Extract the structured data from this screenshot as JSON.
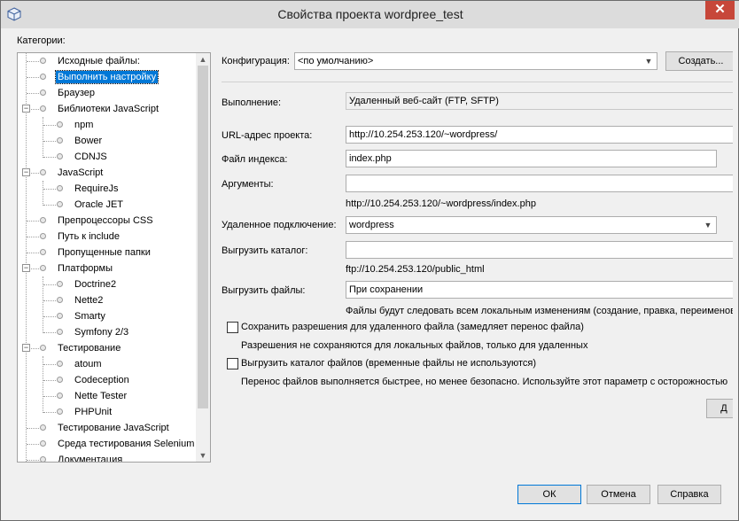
{
  "window": {
    "title": "Свойства проекта wordpree_test",
    "close_label": "✕"
  },
  "categories_label": "Категории:",
  "tree": {
    "items": [
      {
        "label": "Исходные файлы:"
      },
      {
        "label": "Выполнить настройку"
      },
      {
        "label": "Браузер"
      },
      {
        "label": "Библиотеки JavaScript"
      },
      {
        "label": "npm"
      },
      {
        "label": "Bower"
      },
      {
        "label": "CDNJS"
      },
      {
        "label": "JavaScript"
      },
      {
        "label": "RequireJs"
      },
      {
        "label": "Oracle JET"
      },
      {
        "label": "Препроцессоры CSS"
      },
      {
        "label": "Путь к include"
      },
      {
        "label": "Пропущенные папки"
      },
      {
        "label": "Платформы"
      },
      {
        "label": "Doctrine2"
      },
      {
        "label": "Nette2"
      },
      {
        "label": "Smarty"
      },
      {
        "label": "Symfony 2/3"
      },
      {
        "label": "Тестирование"
      },
      {
        "label": "atoum"
      },
      {
        "label": "Codeception"
      },
      {
        "label": "Nette Tester"
      },
      {
        "label": "PHPUnit"
      },
      {
        "label": "Тестирование JavaScript"
      },
      {
        "label": "Среда тестирования Selenium"
      },
      {
        "label": "Документация"
      }
    ]
  },
  "config": {
    "label": "Конфигурация:",
    "value": "<по умолчанию>",
    "create_button": "Создать..."
  },
  "run": {
    "label": "Выполнение:",
    "value": "Удаленный веб-сайт (FTP, SFTP)"
  },
  "url": {
    "label": "URL-адрес проекта:",
    "value": "http://10.254.253.120/~wordpress/"
  },
  "index": {
    "label": "Файл индекса:",
    "value": "index.php"
  },
  "args": {
    "label": "Аргументы:",
    "value": "",
    "hint": "http://10.254.253.120/~wordpress/index.php"
  },
  "remote": {
    "label": "Удаленное подключение:",
    "value": "wordpress"
  },
  "upload_dir": {
    "label": "Выгрузить каталог:",
    "value": "",
    "hint": "ftp://10.254.253.120/public_html"
  },
  "upload_files": {
    "label": "Выгрузить файлы:",
    "value": "При сохранении",
    "hint": "Файлы будут следовать всем локальным изменениям (создание, правка, переименование"
  },
  "perm_checkbox": {
    "label": "Сохранить разрешения для удаленного файла (замедляет перенос файла)",
    "hint": "Разрешения не сохраняются для локальных файлов, только для удаленных"
  },
  "dir_checkbox": {
    "label": "Выгрузить каталог файлов (временные файлы не используются)",
    "hint": "Перенос файлов выполняется быстрее, но менее безопасно. Используйте этот параметр с осторожностью"
  },
  "advanced_button": "Д",
  "buttons": {
    "ok": "ОК",
    "cancel": "Отмена",
    "help": "Справка"
  }
}
